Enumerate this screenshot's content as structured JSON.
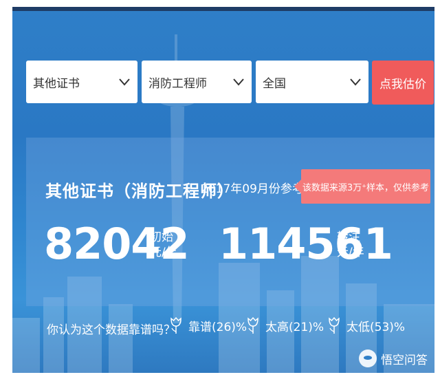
{
  "filters": {
    "certificate": "其他证书",
    "profession": "消防工程师",
    "region": "全国",
    "submit_label": "点我估价"
  },
  "result": {
    "title": "其他证书（消防工程师）",
    "period": "2017年09月份参考价",
    "note": "该数据来源3万⁺样本，仅供参考",
    "starting_salary": "82042",
    "starting_unit_line1": "初始",
    "starting_unit_line2": "元/年",
    "transfer_salary": "114561",
    "transfer_unit_line1": "转注",
    "transfer_unit_line2": "元/年"
  },
  "feedback": {
    "question": "你认为这个数据靠谱吗？",
    "options": [
      {
        "label": "靠谱(26)%"
      },
      {
        "label": "太高(21)%"
      },
      {
        "label": "太低(53)%"
      }
    ]
  },
  "watermark": {
    "text": "悟空问答"
  },
  "colors": {
    "accent_button": "#f05b5b",
    "badge": "#f47a7a",
    "background": "#2f7fc8"
  }
}
